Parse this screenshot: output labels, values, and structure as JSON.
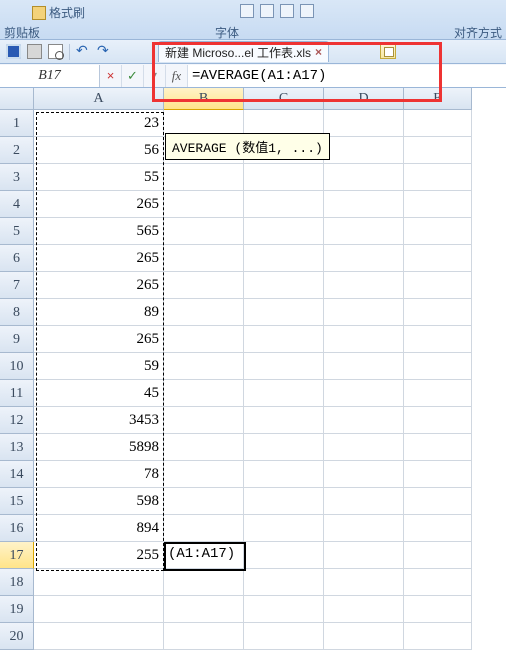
{
  "ribbon": {
    "format_painter": "格式刷",
    "group_clipboard": "剪贴板",
    "group_font": "字体",
    "group_align": "对齐方式"
  },
  "tab": {
    "title": "新建 Microso...el 工作表.xls",
    "close": "×"
  },
  "formula_bar": {
    "namebox": "B17",
    "cancel": "×",
    "enter": "✓",
    "dd": "▾",
    "fx": "fx",
    "formula": "=AVERAGE(A1:A17)"
  },
  "func_tip": "AVERAGE (数值1, ...)",
  "range_echo": "(A1:A17)",
  "columns": [
    "A",
    "B",
    "C",
    "D",
    "E"
  ],
  "active_col": "B",
  "active_row": 17,
  "rows": [
    {
      "n": 1,
      "A": "23"
    },
    {
      "n": 2,
      "A": "56"
    },
    {
      "n": 3,
      "A": "55"
    },
    {
      "n": 4,
      "A": "265"
    },
    {
      "n": 5,
      "A": "565"
    },
    {
      "n": 6,
      "A": "265"
    },
    {
      "n": 7,
      "A": "265"
    },
    {
      "n": 8,
      "A": "89"
    },
    {
      "n": 9,
      "A": "265"
    },
    {
      "n": 10,
      "A": "59"
    },
    {
      "n": 11,
      "A": "45"
    },
    {
      "n": 12,
      "A": "3453"
    },
    {
      "n": 13,
      "A": "5898"
    },
    {
      "n": 14,
      "A": "78"
    },
    {
      "n": 15,
      "A": "598"
    },
    {
      "n": 16,
      "A": "894"
    },
    {
      "n": 17,
      "A": "255"
    },
    {
      "n": 18,
      "A": ""
    },
    {
      "n": 19,
      "A": ""
    },
    {
      "n": 20,
      "A": ""
    }
  ]
}
